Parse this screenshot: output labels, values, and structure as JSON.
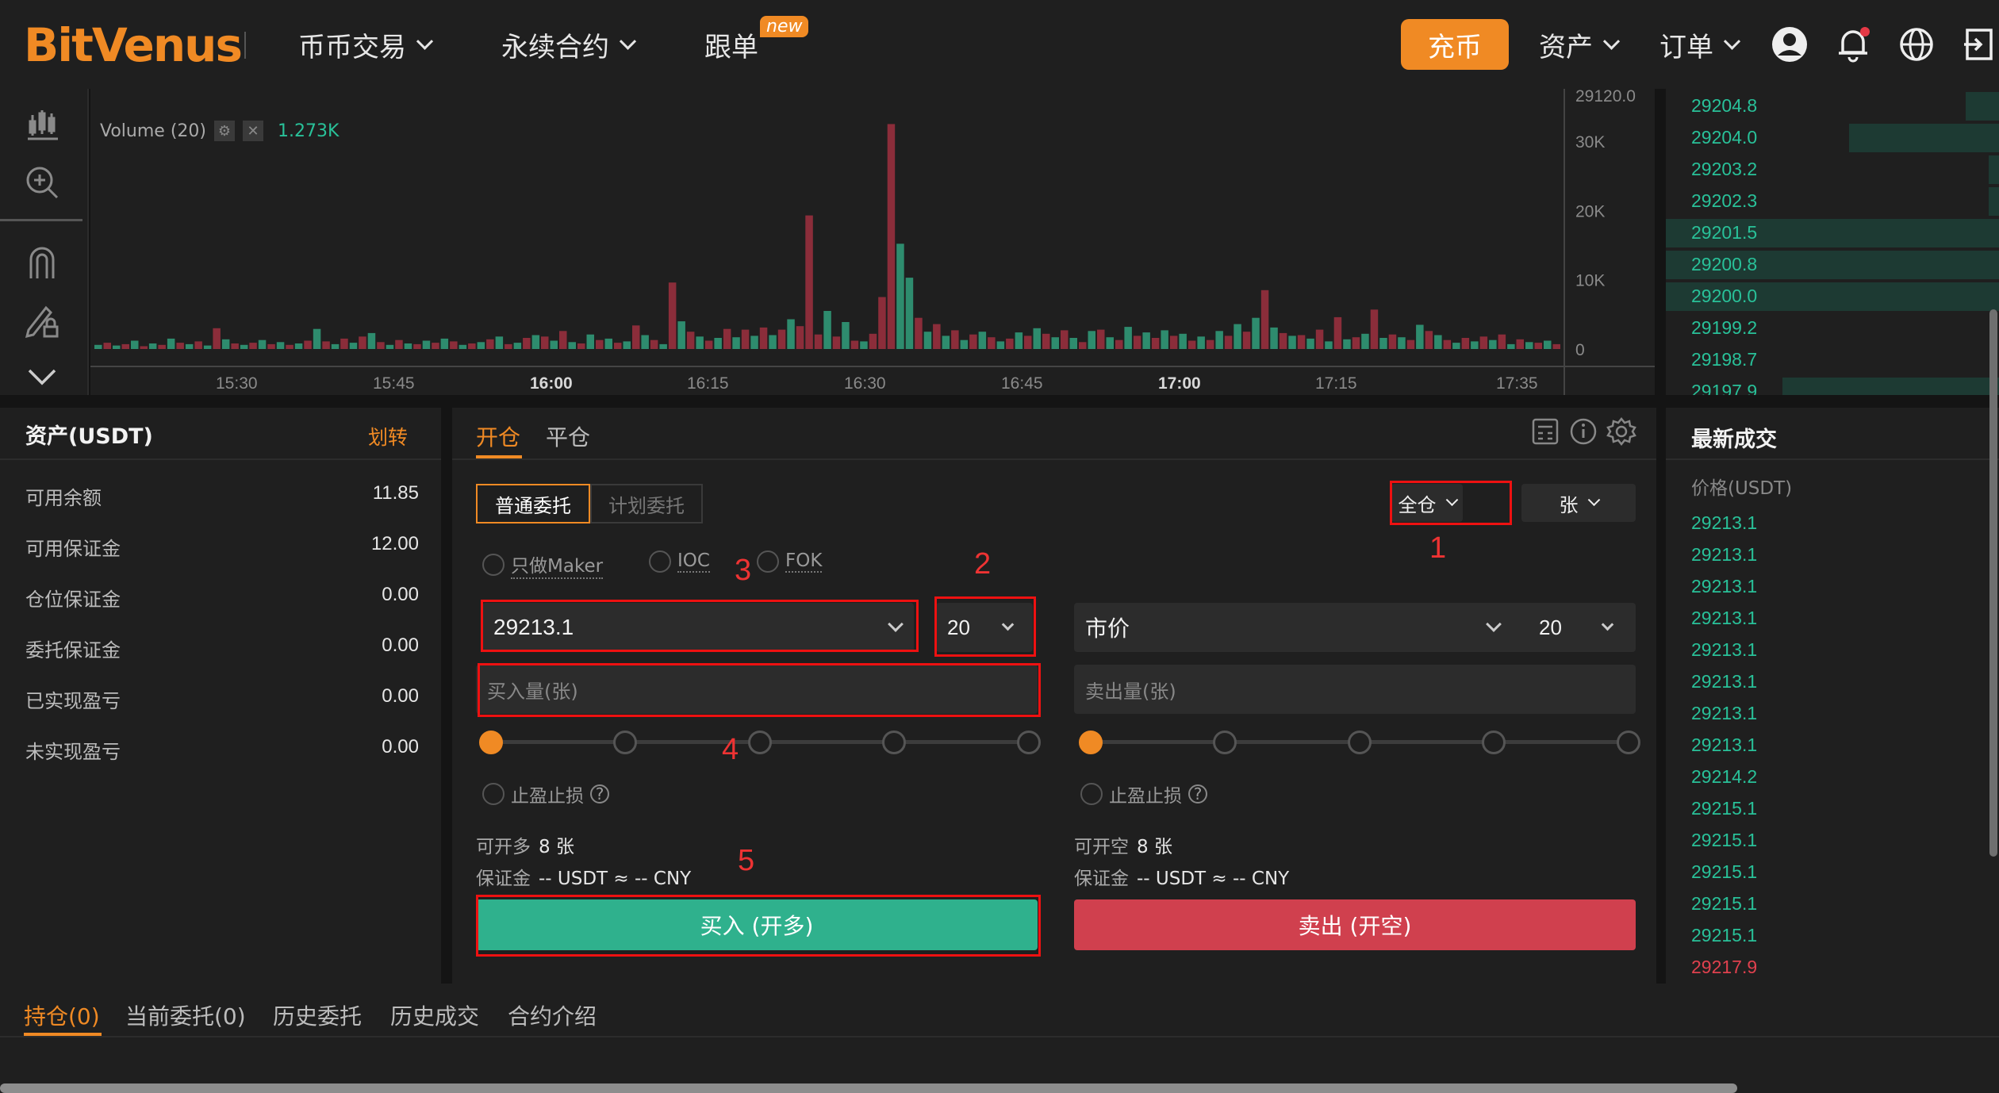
{
  "nav": {
    "logo": "BitVenus",
    "items": [
      "币币交易",
      "永续合约",
      "跟单"
    ],
    "new_badge": "new",
    "deposit": "充币",
    "assets": "资产",
    "orders": "订单"
  },
  "chart": {
    "volume_label": "Volume (20)",
    "volume_value": "1.273K",
    "time_ticks": [
      "15:30",
      "15:45",
      "16:00",
      "16:15",
      "16:30",
      "16:45",
      "17:00",
      "17:15",
      "17:35"
    ],
    "y_ticks": [
      "29120.0",
      "30K",
      "20K",
      "10K",
      "0"
    ]
  },
  "chart_data": {
    "type": "bar",
    "title": "Volume (20)",
    "ylim": [
      0,
      33000
    ],
    "y_ticks": [
      "0",
      "10K",
      "20K",
      "30K"
    ],
    "x_ticks": [
      "15:30",
      "15:45",
      "16:00",
      "16:15",
      "16:30",
      "16:45",
      "17:00",
      "17:15",
      "17:35"
    ],
    "last_value": "1.273K",
    "series": [
      {
        "color_up": "#2e8c6e",
        "color_down": "#8b2d3a",
        "values": [
          600,
          900,
          500,
          700,
          1200,
          400,
          800,
          600,
          1500,
          900,
          700,
          1100,
          500,
          3000,
          1400,
          800,
          600,
          900,
          1300,
          700,
          1000,
          600,
          800,
          1200,
          2900,
          1100,
          700,
          1500,
          900,
          1800,
          2300,
          1000,
          600,
          1300,
          800,
          700,
          1200,
          900,
          1500,
          1100,
          600,
          800,
          1000,
          1400,
          1800,
          700,
          900,
          1600,
          2000,
          1800,
          1200,
          2600,
          1000,
          800,
          2100,
          1300,
          1500,
          900,
          1100,
          3400,
          2000,
          1300,
          700,
          9600,
          4000,
          2500,
          1800,
          1200,
          1600,
          2900,
          1700,
          2800,
          1900,
          3100,
          2000,
          2800,
          4300,
          3300,
          19300,
          2100,
          5500,
          1800,
          3900,
          1200,
          1100,
          2200,
          7500,
          32500,
          15200,
          10300,
          4500,
          2500,
          3600,
          1900,
          2700,
          1300,
          2100,
          2500,
          1700,
          1100,
          1500,
          2400,
          1900,
          3000,
          2200,
          1700,
          2700,
          1600,
          1000,
          2600,
          2800,
          1700,
          1300,
          3200,
          1900,
          2400,
          1600,
          2700,
          1900,
          2200,
          1200,
          1800,
          1300,
          2600,
          1900,
          3600,
          2500,
          4500,
          8500,
          3100,
          2300,
          1900,
          2000,
          1500,
          2800,
          1100,
          4600,
          1400,
          1700,
          2200,
          5700,
          1600,
          2100,
          1700,
          1300,
          3500,
          2600,
          2000,
          1300,
          900,
          1600,
          1100,
          1800,
          1300,
          2100,
          700,
          1400,
          1000,
          900,
          1200,
          700
        ],
        "up_flags": [
          1,
          0,
          1,
          0,
          1,
          0,
          1,
          0,
          1,
          0,
          1,
          0,
          1,
          0,
          1,
          0,
          1,
          0,
          1,
          0,
          1,
          0,
          1,
          0,
          1,
          0,
          1,
          0,
          1,
          0,
          1,
          0,
          1,
          0,
          1,
          0,
          1,
          0,
          1,
          0,
          1,
          0,
          1,
          0,
          1,
          0,
          1,
          0,
          1,
          0,
          1,
          0,
          1,
          0,
          1,
          0,
          1,
          0,
          1,
          0,
          1,
          0,
          1,
          0,
          1,
          0,
          1,
          0,
          1,
          0,
          1,
          0,
          1,
          0,
          1,
          0,
          1,
          0,
          0,
          0,
          1,
          0,
          1,
          0,
          1,
          0,
          0,
          0,
          1,
          1,
          0,
          1,
          0,
          1,
          0,
          1,
          0,
          1,
          0,
          1,
          0,
          1,
          0,
          1,
          0,
          1,
          0,
          1,
          0,
          1,
          0,
          1,
          0,
          1,
          0,
          1,
          0,
          1,
          0,
          1,
          0,
          1,
          0,
          1,
          0,
          1,
          0,
          1,
          0,
          1,
          0,
          1,
          0,
          1,
          0,
          1,
          0,
          1,
          0,
          1,
          0,
          1,
          0,
          1,
          0,
          1,
          0,
          1,
          0,
          1,
          0,
          1,
          0,
          1,
          0,
          1,
          0,
          1,
          0,
          1,
          0,
          1,
          0,
          1,
          0,
          1,
          0,
          1,
          0,
          1,
          0,
          1,
          0,
          1,
          0
        ]
      }
    ]
  },
  "orderbook": {
    "rows": [
      {
        "price": "29204.8",
        "depth": 0.1
      },
      {
        "price": "29204.0",
        "depth": 0.45
      },
      {
        "price": "29203.2",
        "depth": 0.03
      },
      {
        "price": "29202.3",
        "depth": 0.03
      },
      {
        "price": "29201.5",
        "depth": 1.0
      },
      {
        "price": "29200.8",
        "depth": 1.0
      },
      {
        "price": "29200.0",
        "depth": 1.0
      },
      {
        "price": "29199.2",
        "depth": 0.0
      },
      {
        "price": "29198.7",
        "depth": 0.0
      },
      {
        "price": "29197.9",
        "depth": 0.65
      }
    ]
  },
  "assets": {
    "title": "资产(USDT)",
    "transfer": "划转",
    "rows": [
      {
        "label": "可用余额",
        "value": "11.85"
      },
      {
        "label": "可用保证金",
        "value": "12.00"
      },
      {
        "label": "仓位保证金",
        "value": "0.00"
      },
      {
        "label": "委托保证金",
        "value": "0.00"
      },
      {
        "label": "已实现盈亏",
        "value": "0.00"
      },
      {
        "label": "未实现盈亏",
        "value": "0.00"
      }
    ]
  },
  "trade": {
    "tabs": [
      "开仓",
      "平仓"
    ],
    "order_types": [
      "普通委托",
      "计划委托"
    ],
    "margin_mode": "全仓",
    "unit": "张",
    "options": [
      "只做Maker",
      "IOC",
      "FOK"
    ],
    "buy": {
      "price": "29213.1",
      "leverage": "20",
      "amount_placeholder": "买入量(张)",
      "tpsl": "止盈止损",
      "can_open_label": "可开多",
      "can_open_value": "8 张",
      "margin_label": "保证金",
      "margin_value": "-- USDT ≈ -- CNY",
      "button": "买入 (开多)",
      "slider_percent": 0
    },
    "sell": {
      "price_type": "市价",
      "leverage": "20",
      "amount_placeholder": "卖出量(张)",
      "tpsl": "止盈止损",
      "can_open_label": "可开空",
      "can_open_value": "8 张",
      "margin_label": "保证金",
      "margin_value": "-- USDT ≈ -- CNY",
      "button": "卖出 (开空)",
      "slider_percent": 0
    },
    "annotations": [
      "1",
      "2",
      "3",
      "4",
      "5"
    ]
  },
  "trades": {
    "title": "最新成交",
    "price_header": "价格(USDT)",
    "prices": [
      {
        "p": "29213.1",
        "side": "buy"
      },
      {
        "p": "29213.1",
        "side": "buy"
      },
      {
        "p": "29213.1",
        "side": "buy"
      },
      {
        "p": "29213.1",
        "side": "buy"
      },
      {
        "p": "29213.1",
        "side": "buy"
      },
      {
        "p": "29213.1",
        "side": "buy"
      },
      {
        "p": "29213.1",
        "side": "buy"
      },
      {
        "p": "29213.1",
        "side": "buy"
      },
      {
        "p": "29214.2",
        "side": "buy"
      },
      {
        "p": "29215.1",
        "side": "buy"
      },
      {
        "p": "29215.1",
        "side": "buy"
      },
      {
        "p": "29215.1",
        "side": "buy"
      },
      {
        "p": "29215.1",
        "side": "buy"
      },
      {
        "p": "29215.1",
        "side": "buy"
      },
      {
        "p": "29217.9",
        "side": "sell"
      }
    ],
    "buy_color": "#29c199",
    "sell_color": "#e0414e"
  },
  "bottom_tabs": [
    "持仓(0)",
    "当前委托(0)",
    "历史委托",
    "历史成交",
    "合约介绍"
  ],
  "colors": {
    "accent": "#f08a24",
    "buy": "#2fb18d",
    "sell": "#d0404e",
    "annotation": "#ee1111"
  }
}
